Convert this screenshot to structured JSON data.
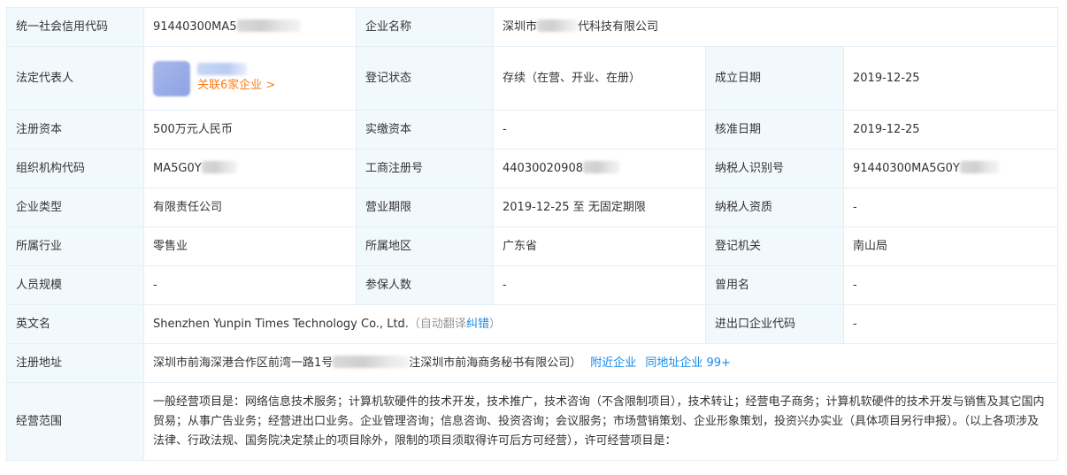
{
  "rows": {
    "credit_code": {
      "label": "统一社会信用代码",
      "value": "91440300MA5"
    },
    "company_name": {
      "label": "企业名称",
      "value_prefix": "深圳市",
      "value_suffix": "代科技有限公司"
    },
    "legal_rep": {
      "label": "法定代表人",
      "related": "关联6家企业 >"
    },
    "reg_status": {
      "label": "登记状态",
      "value": "存续（在营、开业、在册）"
    },
    "founded": {
      "label": "成立日期",
      "value": "2019-12-25"
    },
    "reg_capital": {
      "label": "注册资本",
      "value": "500万元人民币"
    },
    "paid_capital": {
      "label": "实缴资本",
      "value": "-"
    },
    "approved_date": {
      "label": "核准日期",
      "value": "2019-12-25"
    },
    "org_code": {
      "label": "组织机构代码",
      "value": "MA5G0Y"
    },
    "biz_reg_no": {
      "label": "工商注册号",
      "value": "44030020908"
    },
    "taxpayer_id": {
      "label": "纳税人识别号",
      "value": "91440300MA5G0Y"
    },
    "company_type": {
      "label": "企业类型",
      "value": "有限责任公司"
    },
    "biz_term": {
      "label": "营业期限",
      "value": "2019-12-25 至 无固定期限"
    },
    "taxpayer_qual": {
      "label": "纳税人资质",
      "value": "-"
    },
    "industry": {
      "label": "所属行业",
      "value": "零售业"
    },
    "region": {
      "label": "所属地区",
      "value": "广东省"
    },
    "reg_authority": {
      "label": "登记机关",
      "value": "南山局"
    },
    "staff_size": {
      "label": "人员规模",
      "value": "-"
    },
    "insured": {
      "label": "参保人数",
      "value": "-"
    },
    "former_name": {
      "label": "曾用名",
      "value": "-"
    },
    "english_name": {
      "label": "英文名",
      "value": "Shenzhen Yunpin Times Technology Co., Ltd.",
      "auto_translate": "（自动翻译",
      "correct_link": "纠错",
      "close_paren": "）"
    },
    "import_export": {
      "label": "进出口企业代码",
      "value": "-"
    },
    "reg_address": {
      "label": "注册地址",
      "value_prefix": "深圳市前海深港合作区前湾一路1号",
      "value_suffix": "注深圳市前海商务秘书有限公司）",
      "nearby_link": "附近企业",
      "same_address_link": "同地址企业 99+"
    },
    "biz_scope": {
      "label": "经营范围",
      "value": "一般经营项目是：网络信息技术服务；计算机软硬件的技术开发，技术推广，技术咨询（不含限制项目），技术转让；经营电子商务；计算机软硬件的技术开发与销售及其它国内贸易；从事广告业务；经营进出口业务。企业管理咨询；信息咨询、投资咨询；会议服务；市场营销策划、企业形象策划，投资兴办实业（具体项目另行申报）。（以上各项涉及法律、行政法规、国务院决定禁止的项目除外，限制的项目须取得许可后方可经营），许可经营项目是："
    }
  }
}
